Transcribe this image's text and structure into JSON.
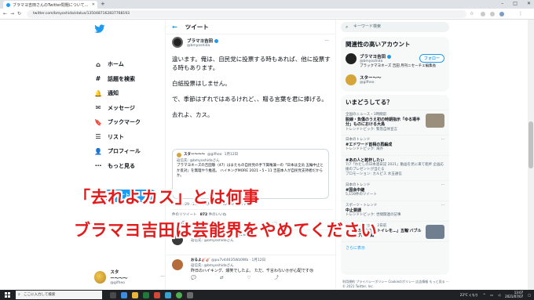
{
  "browser": {
    "tab_title": "ブラマヨ吉田さんのTwitter問題について…",
    "url": "twitter.com/bmyoshida/status/1350487162837768193"
  },
  "sidebar": {
    "items": [
      {
        "label": "ホーム",
        "icon": "home-icon",
        "glyph": "⌂"
      },
      {
        "label": "話題を検索",
        "icon": "hashtag-icon",
        "glyph": "#"
      },
      {
        "label": "通知",
        "icon": "bell-icon",
        "glyph": "🔔"
      },
      {
        "label": "メッセージ",
        "icon": "mail-icon",
        "glyph": "✉"
      },
      {
        "label": "ブックマーク",
        "icon": "bookmark-icon",
        "glyph": "🔖"
      },
      {
        "label": "リスト",
        "icon": "list-icon",
        "glyph": "☰"
      },
      {
        "label": "プロフィール",
        "icon": "profile-icon",
        "glyph": "👤"
      },
      {
        "label": "もっと見る",
        "icon": "more-icon",
        "glyph": "⋯"
      }
    ],
    "tweet_button": "ツイートする",
    "account": {
      "name": "スター〜〜〜",
      "handle": "@gifheo"
    }
  },
  "main": {
    "header": "ツイート",
    "tweet": {
      "author_name": "ブラマヨ吉田",
      "author_handle": "@bmyoshida",
      "lines": [
        "違います。俺は、自民党に投票する時もあれば、他に投票する時もあります。",
        "白紙投票はしません。",
        "で、季節はずれではあるけれど、、贈る言葉を君に捧げる。",
        "去れよ、カス。"
      ],
      "quote": {
        "name": "スター〜〜〜",
        "handle": "@gifheo",
        "date": "1月12日",
        "reply_to": "返信先: @bmyoshidaさん",
        "text": "ブラマヨネーズの吉田敬（47）はまたもの自民党の手下属権兼一の「日本は全员 五輪中止とか反対」を無理やり推進。 ハイキングMORE 2021・5・11 吉田本人が自民党支持者だからか。"
      },
      "meta": "午後11:29 · 2021年1月12日 · Twitter Web App",
      "stats": {
        "rt_label": "件のリツイート",
        "like_count": "872",
        "like_label": "件のいいね"
      }
    },
    "replies": [
      {
        "name": "re",
        "handle": "@masanoribeucnh · 1月12日",
        "reply_to": "返信先: @bmyoshidaさん",
        "text": "",
        "color": "#3a3a3a"
      },
      {
        "name": "おるよ🎸🎸",
        "handle": "@pu7v44635Wz0Wb · 1月12日",
        "reply_to": "返信先: @bmyoshidaさん",
        "text": "昨日のハイキング、爆笑でしたよ。 ただ、千言わないかが心配です😢",
        "color": "#b66b3a"
      }
    ]
  },
  "right": {
    "search_placeholder": "キーワード検索",
    "relevant_title": "関連性の高いアカウント",
    "relevant": [
      {
        "name": "ブラマヨ吉田",
        "handle": "@bmyoshida",
        "bio": "ブラックマヨネーズ 吉田 月刊ニセーチェ編集長",
        "follow": "フォロー",
        "color": "#222"
      },
      {
        "name": "スター〜〜",
        "handle": "@gifheo",
        "bio": "",
        "follow": "",
        "color": "#d6a53a"
      }
    ],
    "trends_title": "いまどうしてる？",
    "trends": [
      {
        "cat": "全国のニュース・3時間前",
        "title": "脱線・負傷のうえ初の時期指示「ゆる場半分」ものにおける大鳥",
        "sub": "トレンドトピック: 緊急自体宣言",
        "thumb": "#9a8f7d"
      },
      {
        "cat": "日本のトレンド",
        "title": "#エドワード首相の再編成",
        "sub": "トレンドトピック: 海外",
        "thumb": ""
      },
      {
        "cat": "",
        "title": "#あの人と乾杯したい",
        "sub": "7/7「わたしの日本酒日記 2021」動画を見に来て乾杯 企画応援のプレゼントが当たる",
        "thumb": ""
      },
      {
        "cat": "",
        "title": "",
        "sub": "プロモーション: カルピス 水玉通信",
        "thumb": ""
      },
      {
        "cat": "日本のトレンド",
        "title": "#国会中継",
        "sub": "5,159件のツイート",
        "thumb": ""
      },
      {
        "cat": "スポーツ・トレンド",
        "title": "中止要請",
        "sub": "トレンドトピック: 世間関連の記事",
        "thumb": ""
      },
      {
        "cat": "地域ステーション・2日前",
        "title": "「一時の商と用しトイレを…」五輪'バブル方式'に穴の負縛",
        "sub": "",
        "thumb": "#6f7f8f"
      }
    ],
    "show_more": "さらに表示",
    "footer": "利用規約 プライバシーポリシー Cookieのポリシー 広告情報 もっと見る ··· © 2021 Twitter, Inc."
  },
  "overlay": {
    "line1": "「去れよカス」とは何事",
    "line2": "ブラマヨ吉田は芸能界をやめてください"
  },
  "taskbar": {
    "search_placeholder": "ここに入力して検索",
    "weather": "23°C くもり",
    "time": "13:07",
    "date": "2021/07/07"
  }
}
